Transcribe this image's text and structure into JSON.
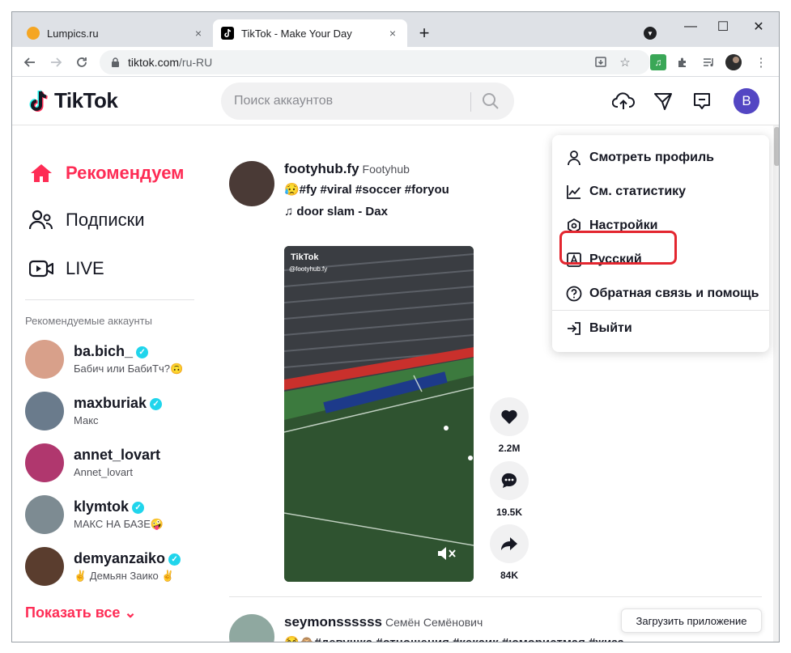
{
  "browser": {
    "tabs": [
      {
        "title": "Lumpics.ru",
        "close": "×",
        "favicon_color": "#f5a623"
      },
      {
        "title": "TikTok - Make Your Day",
        "close": "×"
      }
    ],
    "new_tab": "+",
    "window_controls": {
      "minimize": "—",
      "maximize": "☐",
      "close": "✕"
    },
    "url_host": "tiktok.com",
    "url_path": "/ru-RU"
  },
  "header": {
    "logo_text": "TikTok",
    "search_placeholder": "Поиск аккаунтов",
    "avatar_letter": "B"
  },
  "sidebar": {
    "nav": [
      {
        "label": "Рекомендуем",
        "icon": "home-icon",
        "active": true
      },
      {
        "label": "Подписки",
        "icon": "people-icon",
        "active": false
      },
      {
        "label": "LIVE",
        "icon": "live-icon",
        "active": false
      }
    ],
    "suggested_title": "Рекомендуемые аккаунты",
    "accounts": [
      {
        "username": "ba.bich_",
        "nickname": "Бабич или БабиТч?🙃",
        "color": "#d8a08a"
      },
      {
        "username": "maxburiak",
        "nickname": "Макс",
        "color": "#6a7b8c"
      },
      {
        "username": "annet_lovart",
        "nickname": "Annet_lovart",
        "color": "#b0376e"
      },
      {
        "username": "klymtok",
        "nickname": "МАКС НА БАЗЕ🤪",
        "color": "#7d8b92"
      },
      {
        "username": "demyanzaiko",
        "nickname": "✌ Демьян Заико ✌",
        "color": "#5a3d2e"
      }
    ],
    "show_all": "Показать все"
  },
  "feed": {
    "posts": [
      {
        "author": "footyhub.fy",
        "nickname": "Footyhub",
        "description": "😥#fy #viral #soccer #foryou",
        "music": "♫ door slam - Dax",
        "video_watermark": "TikTok",
        "video_handle": "@footyhub.fy",
        "likes": "2.2M",
        "comments": "19.5K",
        "shares": "84K"
      },
      {
        "author": "seymonssssss",
        "nickname": "Семён Семёнович",
        "description": "😂🙈#девушка #отношения #кексик #юмористмая #жиза"
      }
    ]
  },
  "dropdown": {
    "items": [
      {
        "label": "Смотреть профиль",
        "icon": "person-icon"
      },
      {
        "label": "См. статистику",
        "icon": "chart-icon"
      },
      {
        "label": "Настройки",
        "icon": "gear-icon"
      },
      {
        "label": "Русский",
        "icon": "language-icon"
      },
      {
        "label": "Обратная связь и помощь",
        "icon": "help-icon"
      },
      {
        "label": "Выйти",
        "icon": "logout-icon"
      }
    ]
  },
  "get_app": "Загрузить приложение",
  "colors": {
    "brand_red": "#fe2c55",
    "avatar_purple": "#5346c3",
    "verified": "#20d5ec",
    "highlight": "#e3262f"
  }
}
